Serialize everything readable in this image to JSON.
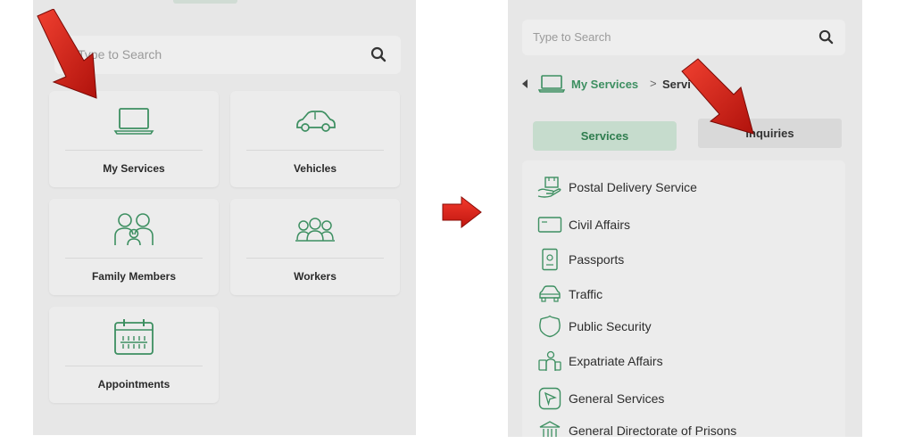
{
  "left_screen": {
    "search": {
      "placeholder": "Type to Search",
      "icon": "search-icon"
    },
    "cards": [
      {
        "label": "My Services",
        "icon": "laptop-icon"
      },
      {
        "label": "Vehicles",
        "icon": "car-icon"
      },
      {
        "label": "Family Members",
        "icon": "family-icon"
      },
      {
        "label": "Workers",
        "icon": "workers-icon"
      },
      {
        "label": "Appointments",
        "icon": "calendar-icon"
      }
    ]
  },
  "right_screen": {
    "search": {
      "placeholder": "Type to Search",
      "icon": "search-icon"
    },
    "breadcrumb": {
      "root": "My Services",
      "separator": ">",
      "current": "Servi"
    },
    "segments": {
      "active": "Services",
      "inactive": "Inquiries"
    },
    "services": [
      {
        "label": "Postal Delivery Service",
        "icon": "postal-hand-icon"
      },
      {
        "label": "Civil Affairs",
        "icon": "id-card-icon"
      },
      {
        "label": "Passports",
        "icon": "passport-icon"
      },
      {
        "label": "Traffic",
        "icon": "traffic-car-icon"
      },
      {
        "label": "Public Security",
        "icon": "security-badge-icon"
      },
      {
        "label": "Expatriate Affairs",
        "icon": "expatriate-icon"
      },
      {
        "label": "General Services",
        "icon": "general-services-icon"
      },
      {
        "label": "General Directorate of Prisons",
        "icon": "prison-building-icon"
      }
    ]
  },
  "colors": {
    "accent_green": "#3d8f61",
    "panel_gray": "#e7e7e7",
    "arrow_red": "#d41a12"
  }
}
